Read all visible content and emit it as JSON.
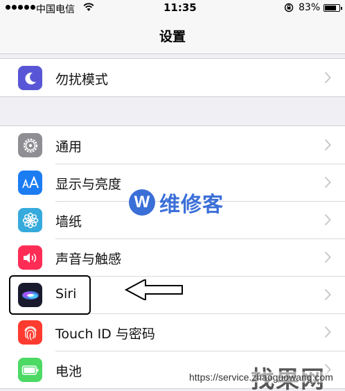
{
  "status_bar": {
    "carrier": "中国电信",
    "time": "11:35",
    "battery": "83%",
    "battery_level": 0.83
  },
  "nav": {
    "title": "设置"
  },
  "groups": [
    {
      "rows": [
        {
          "label": "勿扰模式",
          "icon": "moon-icon",
          "color": "#5856d6"
        }
      ]
    },
    {
      "rows": [
        {
          "label": "通用",
          "icon": "gear-icon",
          "color": "#8e8e93"
        },
        {
          "label": "显示与亮度",
          "icon": "text-size-icon",
          "color": "#1c7cf2"
        },
        {
          "label": "墙纸",
          "icon": "flower-icon",
          "color": "#36aadc"
        },
        {
          "label": "声音与触感",
          "icon": "speaker-icon",
          "color": "#ff2d55"
        },
        {
          "label": "Siri",
          "icon": "siri-icon",
          "color": "#1a1a2e"
        },
        {
          "label": "Touch ID 与密码",
          "icon": "fingerprint-icon",
          "color": "#ff3b30"
        },
        {
          "label": "电池",
          "icon": "battery-icon",
          "color": "#4cd964"
        }
      ]
    }
  ],
  "annotations": {
    "watermark_logo": "W",
    "watermark_text": "维修客",
    "site_badge": "找果网",
    "site_url": "https://service.zhaoguowang.com"
  }
}
